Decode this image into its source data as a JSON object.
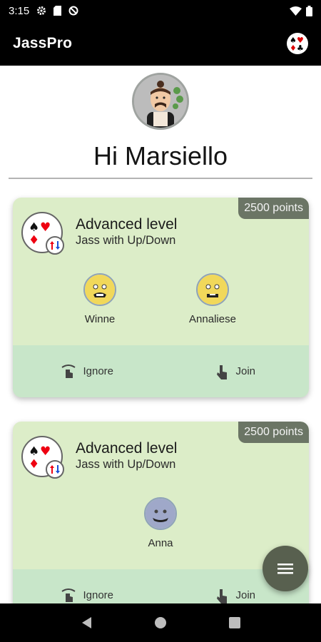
{
  "status_bar": {
    "time": "3:15",
    "icons": [
      "settings-icon",
      "sim-card-icon",
      "data-saver-icon",
      "wifi-icon",
      "battery-icon"
    ]
  },
  "app_bar": {
    "title": "JassPro",
    "action_icon": "cards-suits-icon"
  },
  "profile": {
    "greeting": "Hi Marsiello"
  },
  "games": [
    {
      "points": "2500 points",
      "level": "Advanced level",
      "mode": "Jass with Up/Down",
      "players": [
        {
          "name": "Winne"
        },
        {
          "name": "Annaliese"
        }
      ],
      "actions": {
        "ignore": "Ignore",
        "join": "Join"
      }
    },
    {
      "points": "2500 points",
      "level": "Advanced level",
      "mode": "Jass with Up/Down",
      "players": [
        {
          "name": "Anna"
        }
      ],
      "actions": {
        "ignore": "Ignore",
        "join": "Join"
      }
    }
  ],
  "fab": {
    "icon": "menu-icon"
  },
  "nav": {
    "icons": [
      "back-icon",
      "home-icon",
      "recents-icon"
    ]
  },
  "colors": {
    "card_bg": "#dcedc8",
    "actions_bg": "#c8e6c9",
    "badge_bg": "#6b7565",
    "fab_bg": "#58604f"
  }
}
